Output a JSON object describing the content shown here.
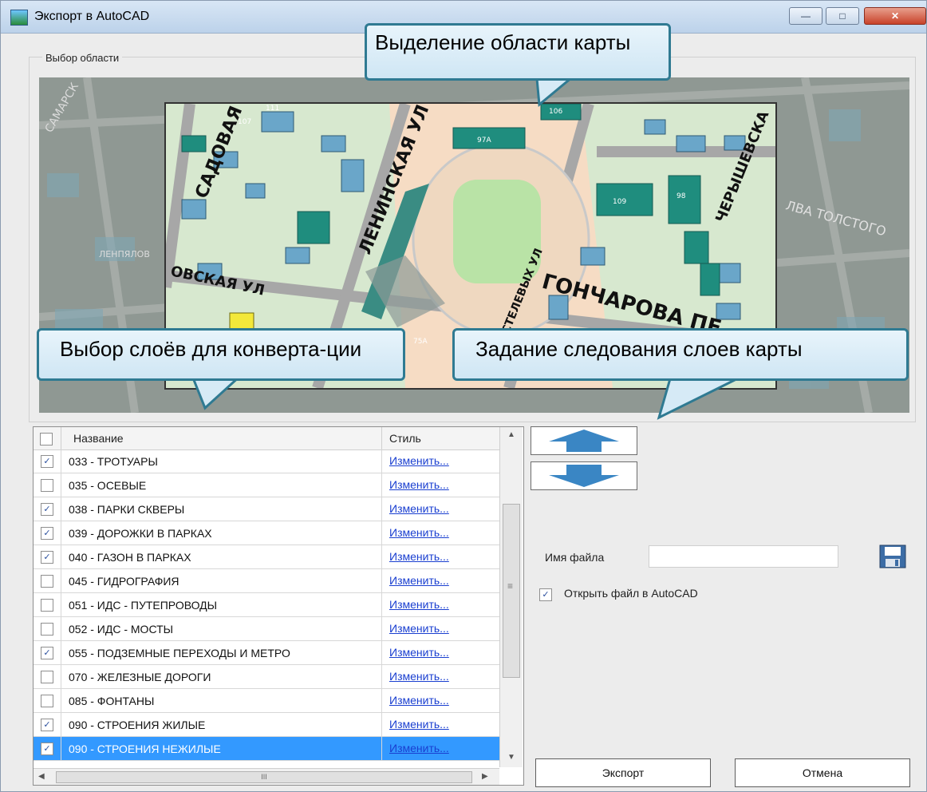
{
  "window": {
    "title": "Экспорт в AutoCAD",
    "min_glyph": "—",
    "max_glyph": "□",
    "close_glyph": "✕"
  },
  "area_group": {
    "title": "Выбор области"
  },
  "map": {
    "labels": [
      "САДОВАЯ УЛ",
      "ЛЕНИНСКАЯ УЛ",
      "ГОНЧАРОВА ПЕ",
      "ОВСКАЯ УЛ",
      "ЧЕРЫШЕВСКА",
      "ОСТЕЛЕВЫХ УЛ",
      "ЛВА ТОЛСТОГО",
      "САМАРСК",
      "ЛЕНПЯЛОВ"
    ],
    "numbers": [
      "111",
      "107",
      "106",
      "97А",
      "109",
      "75А",
      "98"
    ]
  },
  "callouts": {
    "area": "Выделение области карты",
    "layers": "Выбор слоёв для конверта-ции",
    "order": "Задание следования слоев карты"
  },
  "layers_table": {
    "col_name": "Название",
    "col_style": "Стиль",
    "link_label": "Изменить...",
    "rows": [
      {
        "name": "033 - ТРОТУАРЫ",
        "checked": true,
        "selected": false
      },
      {
        "name": "035 - ОСЕВЫЕ",
        "checked": false,
        "selected": false
      },
      {
        "name": "038 - ПАРКИ СКВЕРЫ",
        "checked": true,
        "selected": false
      },
      {
        "name": "039 - ДОРОЖКИ В ПАРКАХ",
        "checked": true,
        "selected": false
      },
      {
        "name": "040 - ГАЗОН В ПАРКАХ",
        "checked": true,
        "selected": false
      },
      {
        "name": "045 - ГИДРОГРАФИЯ",
        "checked": false,
        "selected": false
      },
      {
        "name": "051 - ИДС - ПУТЕПРОВОДЫ",
        "checked": false,
        "selected": false
      },
      {
        "name": "052 - ИДС - МОСТЫ",
        "checked": false,
        "selected": false
      },
      {
        "name": "055 - ПОДЗЕМНЫЕ ПЕРЕХОДЫ И МЕТРО",
        "checked": true,
        "selected": false
      },
      {
        "name": "070 - ЖЕЛЕЗНЫЕ ДОРОГИ",
        "checked": false,
        "selected": false
      },
      {
        "name": "085 - ФОНТАНЫ",
        "checked": false,
        "selected": false
      },
      {
        "name": "090 - СТРОЕНИЯ ЖИЛЫЕ",
        "checked": true,
        "selected": false
      },
      {
        "name": "090 - СТРОЕНИЯ НЕЖИЛЫЕ",
        "checked": true,
        "selected": true
      }
    ],
    "scroll_thumb_glyph": "III",
    "scroll_grip_glyph": "≡"
  },
  "controls": {
    "filename_label": "Имя файла",
    "filename_value": "",
    "open_label": "Открыть файл в AutoCAD",
    "open_checked": true,
    "export_label": "Экспорт",
    "cancel_label": "Отмена",
    "check_glyph": "✓"
  },
  "colors": {
    "accent": "#3399ff",
    "callout_border": "#2f7a92",
    "move_arrow": "#3a86c4",
    "link": "#1a3fd0"
  }
}
